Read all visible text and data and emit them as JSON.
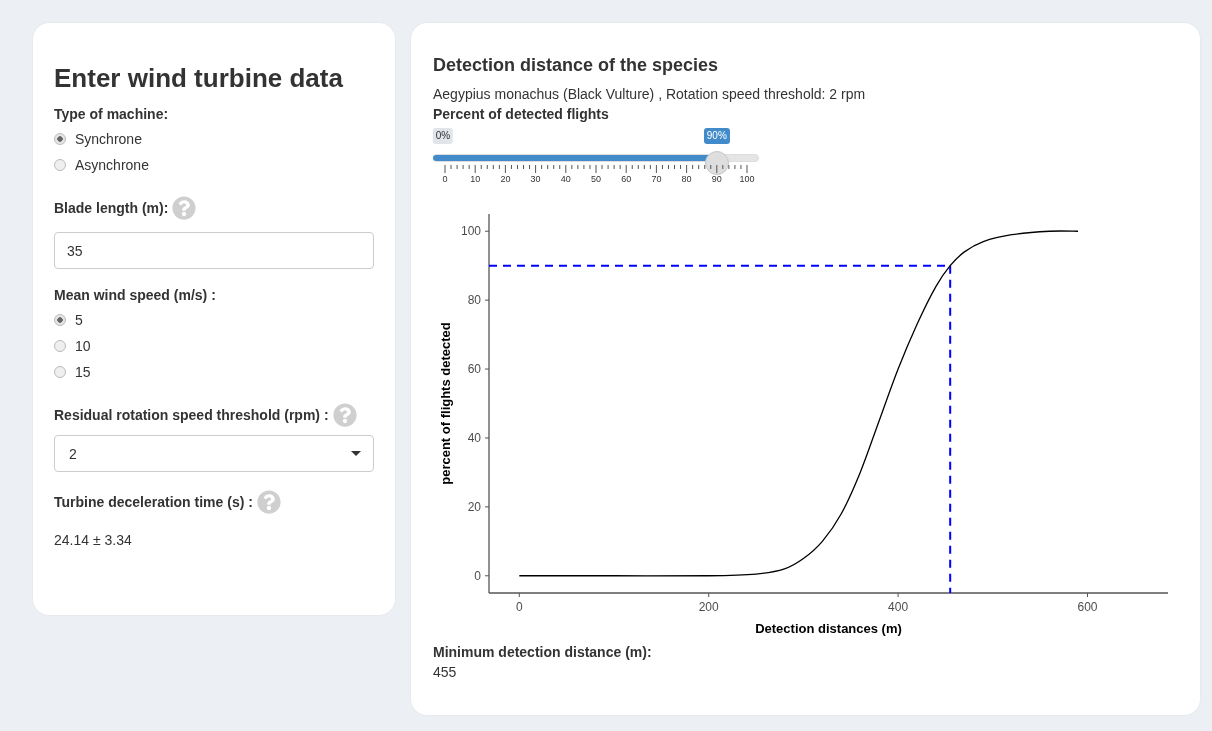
{
  "input_panel": {
    "title": "Enter wind turbine data",
    "fields": [
      {
        "kind": "radio",
        "label": "Type of machine:",
        "help": false,
        "options": [
          {
            "label": "Synchrone",
            "selected": true
          },
          {
            "label": "Asynchrone",
            "selected": false
          }
        ]
      },
      {
        "kind": "text",
        "label": "Blade length (m):",
        "help": true,
        "value": "35"
      },
      {
        "kind": "radio",
        "label": "Mean wind speed (m/s) :",
        "help": false,
        "options": [
          {
            "label": "5",
            "selected": true
          },
          {
            "label": "10",
            "selected": false
          },
          {
            "label": "15",
            "selected": false
          }
        ]
      },
      {
        "kind": "select",
        "label": "Residual rotation speed threshold (rpm) :",
        "help": true,
        "value": "2"
      },
      {
        "kind": "output",
        "label": "Turbine deceleration time (s) :",
        "help": true,
        "value": "24.14 ± 3.34"
      }
    ]
  },
  "result_panel": {
    "title": "Detection distance of the species",
    "subtitle": "Aegypius monachus (Black Vulture) , Rotation speed threshold: 2 rpm",
    "slider": {
      "label": "Percent of detected flights",
      "min_label": "0%",
      "value_label": "90%",
      "level": 0.9,
      "ticks": [
        "0",
        "10",
        "20",
        "30",
        "40",
        "50",
        "60",
        "70",
        "80",
        "90",
        "100"
      ]
    },
    "chart_data": {
      "type": "line",
      "xlabel": "Detection distances (m)",
      "ylabel": "percent of flights detected",
      "x": [
        0,
        100,
        200,
        250,
        280,
        300,
        320,
        340,
        360,
        380,
        400,
        420,
        440,
        455,
        470,
        490,
        520,
        560,
        590
      ],
      "series": [
        {
          "color": "#000000",
          "values": [
            0,
            0,
            0,
            0.5,
            2,
            5,
            10,
            18,
            30,
            45,
            60,
            73,
            84,
            90,
            94,
            97,
            99,
            100,
            100
          ]
        }
      ],
      "xlim": [
        -32,
        685
      ],
      "ylim": [
        -5,
        105
      ],
      "xticks": [
        0,
        200,
        400,
        600
      ],
      "yticks": [
        0,
        20,
        40,
        60,
        80,
        100
      ],
      "ref_lines": [
        {
          "axis": "y",
          "value": 90,
          "color": "#0000ff"
        },
        {
          "axis": "x",
          "value": 455,
          "color": "#0000ff"
        }
      ]
    },
    "result_label": "Minimum detection distance (m):",
    "result_value": "455"
  }
}
